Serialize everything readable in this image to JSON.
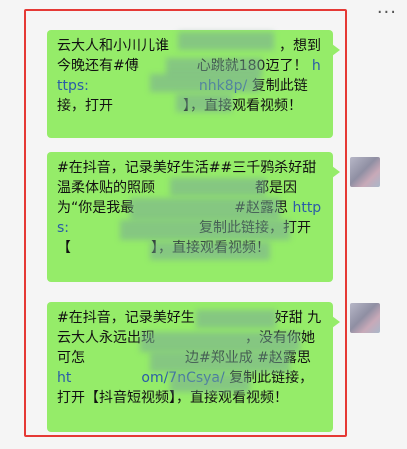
{
  "header": {
    "more_label": "···"
  },
  "messages": [
    {
      "text_a": "云大人和小川儿谁",
      "text_b": "，想到今晚还有#傅",
      "text_c": "心跳就180迈了！",
      "link_a": "https:",
      "link_b": "nhk8p/",
      "text_d": "复制此链接，打开",
      "text_e": "】，直接观看视频！"
    },
    {
      "text_a": "#在抖音，记录美好生活##三千鸦杀好甜 温柔体贴的照顾",
      "text_b": "都是因为“你是我最",
      "text_c": "#赵露思",
      "link_a": "https:",
      "text_d": "复制此链接，打开【",
      "text_e": "】，直接观看视频！"
    },
    {
      "text_a": "#在抖音，记录美好生",
      "text_b": "好甜 九云大人永远出现",
      "text_c": "，没有你她可怎",
      "text_d": "边#郑业成 #赵露思",
      "link_a": "ht",
      "link_b": "om/7nCsya/",
      "text_e": "复制此链接，打开【抖音短视频】，直接观看视频！"
    }
  ]
}
